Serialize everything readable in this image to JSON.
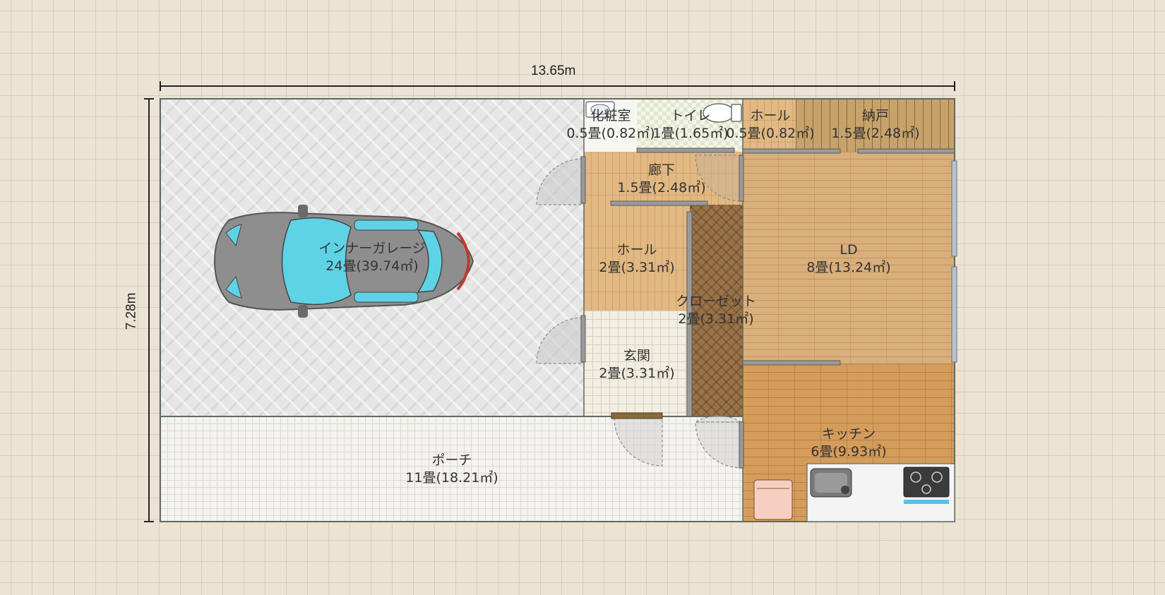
{
  "dimensions": {
    "width_label": "13.65m",
    "height_label": "7.28m"
  },
  "rooms": {
    "garage": {
      "name": "インナーガレージ",
      "area": "24畳(39.74㎡)"
    },
    "powder": {
      "name": "化粧室",
      "area": "0.5畳(0.82㎡)"
    },
    "toilet": {
      "name": "トイレ",
      "area": "1畳(1.65㎡)"
    },
    "hall_small": {
      "name": "ホール",
      "area": "0.5畳(0.82㎡)"
    },
    "storage": {
      "name": "納戸",
      "area": "1.5畳(2.48㎡)"
    },
    "corridor": {
      "name": "廊下",
      "area": "1.5畳(2.48㎡)"
    },
    "hall": {
      "name": "ホール",
      "area": "2畳(3.31㎡)"
    },
    "closet": {
      "name": "クローゼット",
      "area": "2畳(3.31㎡)"
    },
    "ld": {
      "name": "LD",
      "area": "8畳(13.24㎡)"
    },
    "genkan": {
      "name": "玄関",
      "area": "2畳(3.31㎡)"
    },
    "kitchen": {
      "name": "キッチン",
      "area": "6畳(9.93㎡)"
    },
    "porch": {
      "name": "ポーチ",
      "area": "11畳(18.21㎡)"
    }
  },
  "colors": {
    "canvas": "#ebe3d4",
    "outline": "#5f6b5f",
    "dimension_line": "#222222",
    "car_body": "#8e8e8e",
    "car_glass": "#5fd3e6",
    "door_swing": "#9a9a9a"
  },
  "icons": [
    "car-icon",
    "toilet-icon",
    "sink-icon",
    "faucet-icon",
    "stove-icon",
    "dishwasher-icon",
    "stairs-icon"
  ]
}
